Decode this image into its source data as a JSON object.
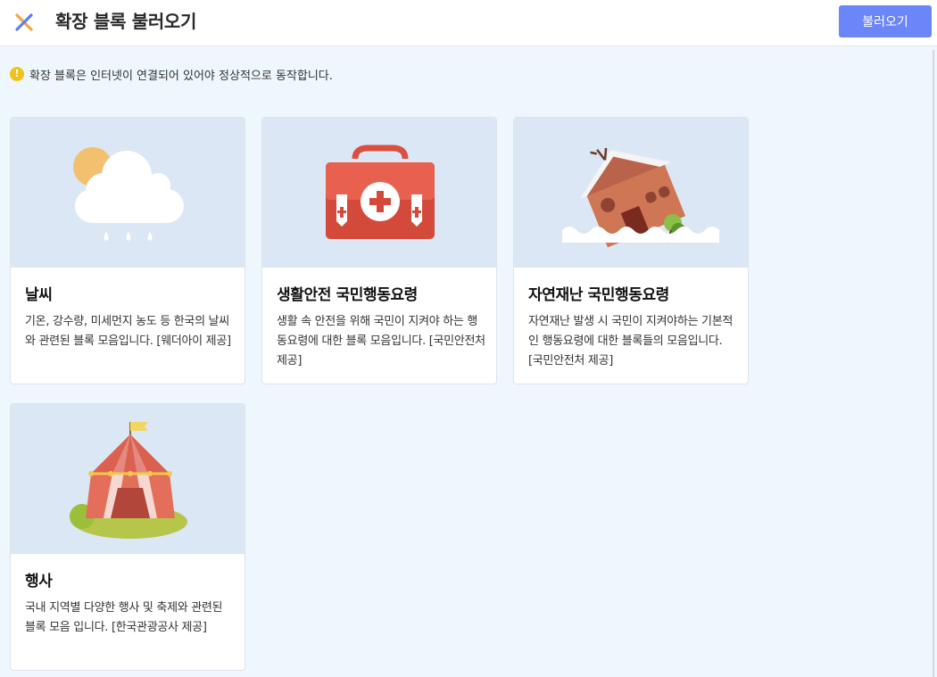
{
  "header": {
    "title": "확장 블록 불러오기",
    "load_button_label": "불러오기"
  },
  "notice": {
    "text": "확장 블록은 인터넷이 연결되어 있어야 정상적으로 동작합니다."
  },
  "cards": [
    {
      "icon": "weather-icon",
      "title": "날씨",
      "description": "기온, 강수량, 미세먼지 농도 등 한국의 날씨와 관련된 블록 모음입니다. [웨더아이 제공]"
    },
    {
      "icon": "first-aid-kit-icon",
      "title": "생활안전 국민행동요령",
      "description": "생활 속 안전을 위해 국민이 지켜야 하는 행동요령에 대한 블록 모음입니다. [국민안전처 제공]"
    },
    {
      "icon": "flooded-house-icon",
      "title": "자연재난 국민행동요령",
      "description": "자연재난 발생 시 국민이 지켜야하는 기본적인 행동요령에 대한 블록들의 모음입니다. [국민안전처 제공]"
    },
    {
      "icon": "circus-tent-icon",
      "title": "행사",
      "description": "국내 지역별 다양한 행사 및 축제와 관련된 블록 모음 입니다. [한국관광공사 제공]"
    }
  ],
  "colors": {
    "accent": "#6b86f9",
    "background": "#eef7fd",
    "card_image_bg": "#dbe7f4",
    "warning": "#f1c21b"
  }
}
